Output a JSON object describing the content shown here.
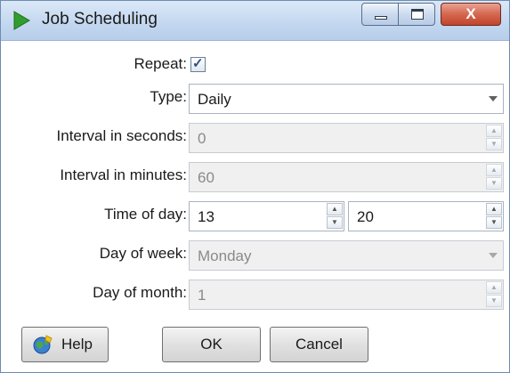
{
  "window": {
    "title": "Job Scheduling",
    "close_glyph": "X",
    "accent": "#2f9e2f"
  },
  "form": {
    "repeat_label": "Repeat:",
    "repeat_checked": true,
    "type_label": "Type:",
    "type_value": "Daily",
    "interval_seconds_label": "Interval in seconds:",
    "interval_seconds_value": "0",
    "interval_minutes_label": "Interval in minutes:",
    "interval_minutes_value": "60",
    "time_of_day_label": "Time of day:",
    "time_hour_value": "13",
    "time_minute_value": "20",
    "day_of_week_label": "Day of week:",
    "day_of_week_value": "Monday",
    "day_of_month_label": "Day of month:",
    "day_of_month_value": "1"
  },
  "buttons": {
    "help_label": "Help",
    "ok_label": "OK",
    "cancel_label": "Cancel"
  },
  "icons": {
    "app": "play-triangle-icon",
    "help": "globe-help-icon",
    "minimize": "minimize-icon",
    "maximize": "maximize-icon",
    "close": "close-icon",
    "dropdown": "chevron-down-icon",
    "spin_up": "spin-up-icon",
    "spin_down": "spin-down-icon"
  }
}
